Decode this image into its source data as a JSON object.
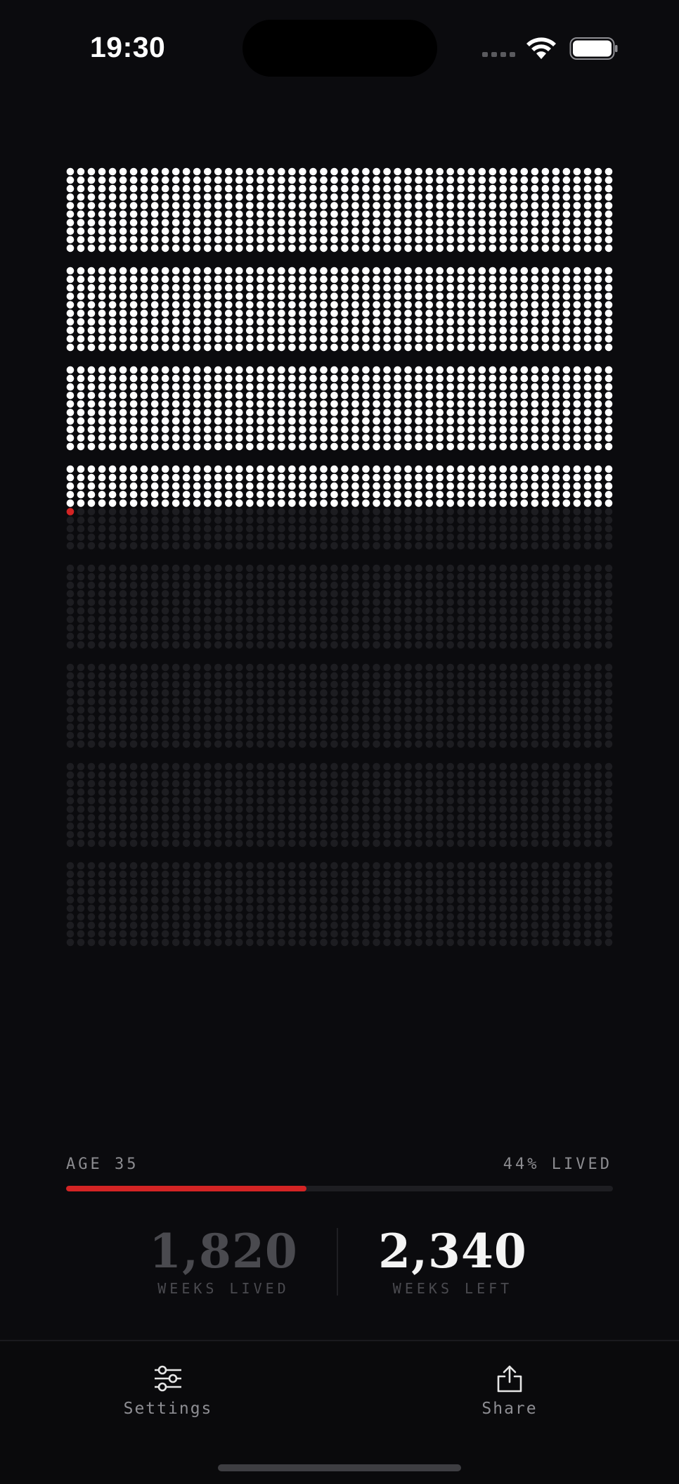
{
  "status_bar": {
    "time": "19:30"
  },
  "life": {
    "total_weeks": 4160,
    "weeks_per_row": 52,
    "rows_per_block": 10,
    "current_week_index": 1820,
    "colors": {
      "lived": "#ffffff",
      "current": "#d42424",
      "future": "#1d1d21"
    }
  },
  "progress": {
    "age_label": "AGE 35",
    "lived_label": "44% LIVED",
    "fraction": 0.44
  },
  "stats": {
    "lived_value": "1,820",
    "lived_caption": "WEEKS LIVED",
    "left_value": "2,340",
    "left_caption": "WEEKS LEFT"
  },
  "tabs": {
    "settings_label": "Settings",
    "share_label": "Share"
  }
}
